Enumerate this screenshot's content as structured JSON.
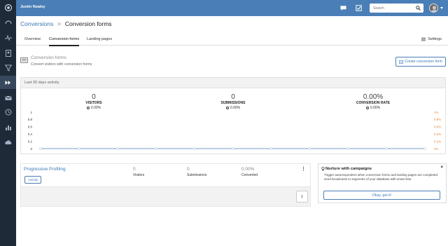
{
  "topbar": {
    "user_name": "Justin Nealey",
    "search_placeholder": "Search"
  },
  "breadcrumb": {
    "parent": "Conversions",
    "separator": ">",
    "current": "Conversion forms"
  },
  "tabs": [
    {
      "label": "Overview",
      "active": false
    },
    {
      "label": "Conversion forms",
      "active": true
    },
    {
      "label": "Landing pages",
      "active": false
    }
  ],
  "settings_label": "Settings",
  "section": {
    "title": "Conversion forms",
    "subtitle": "Convert visitors with conversion forms",
    "create_button": "Create conversion form"
  },
  "activity": {
    "title": "Last 30 days activity",
    "stats": [
      {
        "value": "0",
        "label": "VISITORS",
        "delta": "0.00%"
      },
      {
        "value": "0",
        "label": "SUBMISSIONS",
        "delta": "0.00%"
      },
      {
        "value": "0.00%",
        "label": "CONVERSION RATE",
        "delta": "0.00%"
      }
    ]
  },
  "chart_data": {
    "type": "line",
    "left_axis_ticks": [
      "1",
      "0.8",
      "0.6",
      "0.4",
      "0.2",
      "0"
    ],
    "right_axis_ticks": [
      "1%",
      "0.8%",
      "0.6%",
      "0.4%",
      "0.2%",
      "0%"
    ],
    "ylim_left": [
      0,
      1
    ],
    "ylim_right": [
      0,
      1
    ],
    "series": [
      {
        "values": [
          0,
          0,
          0,
          0,
          0,
          0,
          0,
          0,
          0,
          0,
          0,
          0,
          0,
          0,
          0,
          0,
          0,
          0,
          0,
          0,
          0,
          0,
          0,
          0,
          0,
          0,
          0,
          0,
          0,
          0,
          0
        ]
      }
    ],
    "colors": {
      "line": "#4a7eb6",
      "right_axis": "#e8883a",
      "left_axis": "#333333"
    }
  },
  "forms": [
    {
      "name": "Progressive Profiling",
      "badge": "Activity",
      "visitors_value": "0",
      "visitors_label": "Visitors",
      "submissions_value": "0",
      "submissions_label": "Submissions",
      "converted_value": "0.00%",
      "converted_label": "Converted",
      "menu": "⋮"
    }
  ],
  "pagination": {
    "page": "1"
  },
  "nurture": {
    "title": "Nurture with campaigns",
    "close": "×",
    "text": "Trigger autoresponders when conversion forms and landing pages are completed, send broadcasts to segments of your database with smart lists.",
    "button": "Okay, got it!"
  },
  "colors": {
    "rail": "#1f2a38",
    "topbar": "#4a7eb6",
    "accent": "#3a78b8"
  }
}
